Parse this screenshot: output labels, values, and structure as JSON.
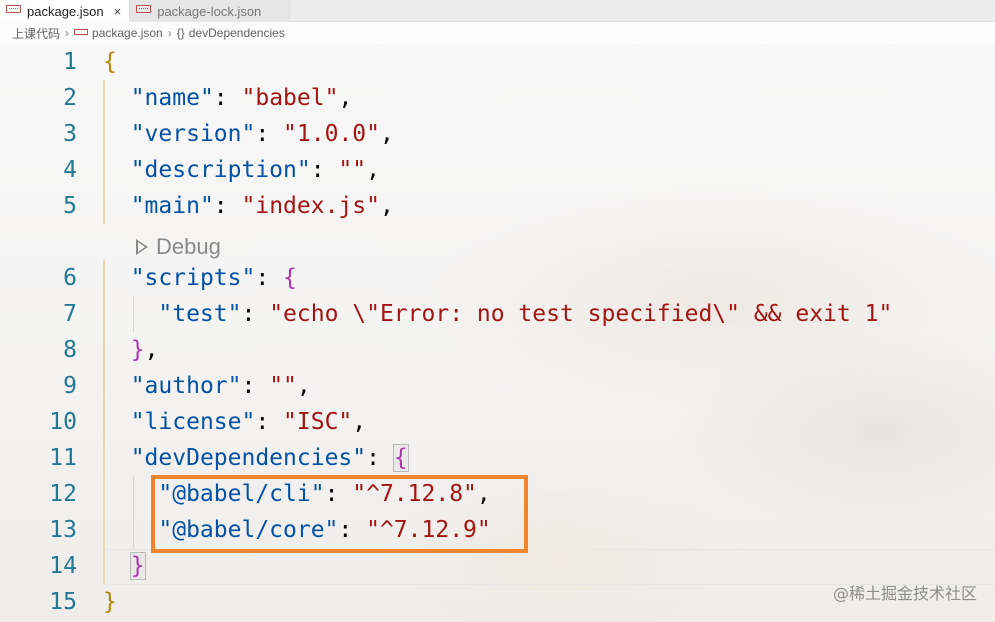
{
  "tabs": [
    {
      "label": "package.json",
      "active": true,
      "close": "×"
    },
    {
      "label": "package-lock.json",
      "active": false
    }
  ],
  "breadcrumb": {
    "folder": "上课代码",
    "file": "package.json",
    "symbol_glyph": "{}",
    "symbol": "devDependencies"
  },
  "codelens": {
    "label": "Debug",
    "icon": "play-outline-icon"
  },
  "lines": [
    {
      "num": "1",
      "tokens": [
        {
          "t": "{",
          "c": "brace-y"
        }
      ]
    },
    {
      "num": "2",
      "tokens": [
        {
          "t": "  ",
          "c": "punc"
        },
        {
          "t": "\"name\"",
          "c": "key"
        },
        {
          "t": ": ",
          "c": "punc"
        },
        {
          "t": "\"babel\"",
          "c": "str"
        },
        {
          "t": ",",
          "c": "punc"
        }
      ]
    },
    {
      "num": "3",
      "tokens": [
        {
          "t": "  ",
          "c": "punc"
        },
        {
          "t": "\"version\"",
          "c": "key"
        },
        {
          "t": ": ",
          "c": "punc"
        },
        {
          "t": "\"1.0.0\"",
          "c": "str"
        },
        {
          "t": ",",
          "c": "punc"
        }
      ]
    },
    {
      "num": "4",
      "tokens": [
        {
          "t": "  ",
          "c": "punc"
        },
        {
          "t": "\"description\"",
          "c": "key"
        },
        {
          "t": ": ",
          "c": "punc"
        },
        {
          "t": "\"\"",
          "c": "str"
        },
        {
          "t": ",",
          "c": "punc"
        }
      ]
    },
    {
      "num": "5",
      "tokens": [
        {
          "t": "  ",
          "c": "punc"
        },
        {
          "t": "\"main\"",
          "c": "key"
        },
        {
          "t": ": ",
          "c": "punc"
        },
        {
          "t": "\"index.js\"",
          "c": "str"
        },
        {
          "t": ",",
          "c": "punc"
        }
      ]
    },
    {
      "num": "6",
      "tokens": [
        {
          "t": "  ",
          "c": "punc"
        },
        {
          "t": "\"scripts\"",
          "c": "key"
        },
        {
          "t": ": ",
          "c": "punc"
        },
        {
          "t": "{",
          "c": "brace-p"
        }
      ]
    },
    {
      "num": "7",
      "tokens": [
        {
          "t": "    ",
          "c": "punc"
        },
        {
          "t": "\"test\"",
          "c": "key"
        },
        {
          "t": ": ",
          "c": "punc"
        },
        {
          "t": "\"echo \\\"Error: no test specified\\\" && exit 1\"",
          "c": "str"
        }
      ]
    },
    {
      "num": "8",
      "tokens": [
        {
          "t": "  ",
          "c": "punc"
        },
        {
          "t": "}",
          "c": "brace-p"
        },
        {
          "t": ",",
          "c": "punc"
        }
      ]
    },
    {
      "num": "9",
      "tokens": [
        {
          "t": "  ",
          "c": "punc"
        },
        {
          "t": "\"author\"",
          "c": "key"
        },
        {
          "t": ": ",
          "c": "punc"
        },
        {
          "t": "\"\"",
          "c": "str"
        },
        {
          "t": ",",
          "c": "punc"
        }
      ]
    },
    {
      "num": "10",
      "tokens": [
        {
          "t": "  ",
          "c": "punc"
        },
        {
          "t": "\"license\"",
          "c": "key"
        },
        {
          "t": ": ",
          "c": "punc"
        },
        {
          "t": "\"ISC\"",
          "c": "str"
        },
        {
          "t": ",",
          "c": "punc"
        }
      ]
    },
    {
      "num": "11",
      "tokens": [
        {
          "t": "  ",
          "c": "punc"
        },
        {
          "t": "\"devDependencies\"",
          "c": "key"
        },
        {
          "t": ": ",
          "c": "punc"
        },
        {
          "t": "{",
          "c": "brace-p bracket-box"
        }
      ]
    },
    {
      "num": "12",
      "tokens": [
        {
          "t": "    ",
          "c": "punc"
        },
        {
          "t": "\"@babel/cli\"",
          "c": "key"
        },
        {
          "t": ": ",
          "c": "punc"
        },
        {
          "t": "\"^7.12.8\"",
          "c": "str"
        },
        {
          "t": ",",
          "c": "punc"
        }
      ]
    },
    {
      "num": "13",
      "tokens": [
        {
          "t": "    ",
          "c": "punc"
        },
        {
          "t": "\"@babel/core\"",
          "c": "key"
        },
        {
          "t": ": ",
          "c": "punc"
        },
        {
          "t": "\"^7.12.9\"",
          "c": "str"
        }
      ]
    },
    {
      "num": "14",
      "tokens": [
        {
          "t": "  ",
          "c": "punc"
        },
        {
          "t": "}",
          "c": "brace-p bracket-box"
        }
      ]
    },
    {
      "num": "15",
      "tokens": [
        {
          "t": "}",
          "c": "brace-y"
        }
      ]
    }
  ],
  "watermark": "@稀土掘金技术社区",
  "colors": {
    "highlight_box": "#f0852d",
    "line_number": "#237893",
    "key": "#0451a5",
    "string": "#a31515"
  }
}
